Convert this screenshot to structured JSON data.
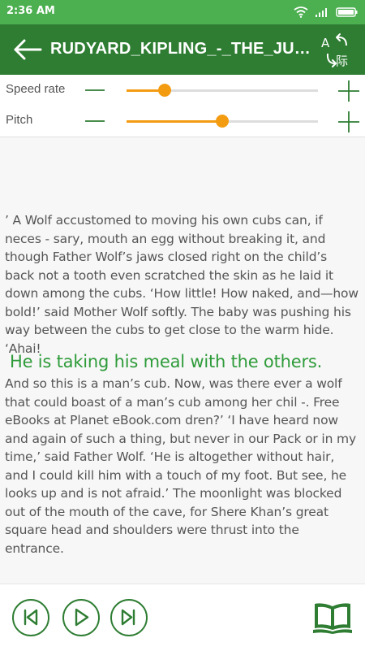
{
  "status": {
    "time": "2:36 AM"
  },
  "toolbar": {
    "title": "RUDYARD_KIPLING_-_THE_JUNGLE_BOOK"
  },
  "controls": {
    "speed": {
      "label": "Speed rate",
      "value": 0.2
    },
    "pitch": {
      "label": "Pitch",
      "value": 0.5
    }
  },
  "reader": {
    "paragraph1": "’ A Wolf accustomed to moving his own cubs can, if neces - sary, mouth an egg without breaking it, and though Father Wolf’s jaws closed right on the child’s back not a tooth even scratched the skin as he laid it down among the cubs. ‘How little! How naked, and—how bold!’ said Mother Wolf softly. The baby was pushing his way between the cubs to get close to the warm hide. ‘Ahai!",
    "highlighted": "He is taking his meal with the others.",
    "paragraph2": " And so this is a man’s cub. Now, was there ever a wolf that could boast of a man’s cub among her chil -.   Free eBooks at Planet eBook.com dren?’ ‘I have heard now and again of such a thing, but never in our Pack or in my time,’ said Father Wolf. ‘He is altogether without hair, and I could kill him with a touch of my foot. But see, he looks up and is not afraid.’ The moonlight was blocked out of the mouth of the cave, for Shere Khan’s great square head and shoulders were thrust into the entrance."
  },
  "colors": {
    "primary": "#2e7d32",
    "status": "#4caf50",
    "accent": "#f39c12",
    "highlight": "#2e9b3a"
  }
}
